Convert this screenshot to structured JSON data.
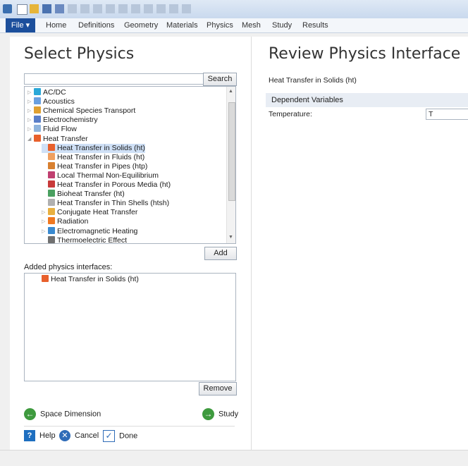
{
  "ribbon": {
    "file_label": "File ▾",
    "tabs": [
      "Home",
      "Definitions",
      "Geometry",
      "Materials",
      "Physics",
      "Mesh",
      "Study",
      "Results"
    ]
  },
  "left": {
    "title": "Select Physics",
    "search_button": "Search",
    "tree": [
      {
        "label": "AC/DC",
        "tri": "▷",
        "indent": 0,
        "icon": "acdc"
      },
      {
        "label": "Acoustics",
        "tri": "▷",
        "indent": 0,
        "icon": "acoustics"
      },
      {
        "label": "Chemical Species Transport",
        "tri": "▷",
        "indent": 0,
        "icon": "chem"
      },
      {
        "label": "Electrochemistry",
        "tri": "▷",
        "indent": 0,
        "icon": "echem"
      },
      {
        "label": "Fluid Flow",
        "tri": "▷",
        "indent": 0,
        "icon": "fluid"
      },
      {
        "label": "Heat Transfer",
        "tri": "◢",
        "indent": 0,
        "icon": "heat"
      },
      {
        "label": "Heat Transfer in Solids (ht)",
        "tri": "",
        "indent": 1,
        "icon": "solids",
        "selected": true
      },
      {
        "label": "Heat Transfer in Fluids (ht)",
        "tri": "",
        "indent": 1,
        "icon": "fluids"
      },
      {
        "label": "Heat Transfer in Pipes (htp)",
        "tri": "",
        "indent": 1,
        "icon": "pipes"
      },
      {
        "label": "Local Thermal Non-Equilibrium",
        "tri": "",
        "indent": 1,
        "icon": "ltne"
      },
      {
        "label": "Heat Transfer in Porous Media (ht)",
        "tri": "",
        "indent": 1,
        "icon": "porous"
      },
      {
        "label": "Bioheat Transfer (ht)",
        "tri": "",
        "indent": 1,
        "icon": "bio"
      },
      {
        "label": "Heat Transfer in Thin Shells (htsh)",
        "tri": "",
        "indent": 1,
        "icon": "shell"
      },
      {
        "label": "Conjugate Heat Transfer",
        "tri": "▷",
        "indent": 1,
        "icon": "conj"
      },
      {
        "label": "Radiation",
        "tri": "▷",
        "indent": 1,
        "icon": "rad"
      },
      {
        "label": "Electromagnetic Heating",
        "tri": "▷",
        "indent": 1,
        "icon": "emh"
      },
      {
        "label": "Thermoelectric Effect",
        "tri": "",
        "indent": 1,
        "icon": "thermo"
      }
    ],
    "add_button": "Add",
    "added_label": "Added physics interfaces:",
    "added_items": [
      "Heat Transfer in Solids (ht)"
    ],
    "remove_button": "Remove",
    "space_dimension": "Space Dimension",
    "study": "Study",
    "help": "Help",
    "cancel": "Cancel",
    "done": "Done"
  },
  "right": {
    "title": "Review Physics Interface",
    "subtitle": "Heat Transfer in Solids (ht)",
    "section": "Dependent Variables",
    "temperature_label": "Temperature:",
    "temperature_value": "T"
  },
  "colors": {
    "file_button": "#1c4f9c",
    "selection": "#cfe0f6",
    "nav_green": "#3e9a3e",
    "help_blue": "#1e6fc0",
    "heat_orange": "#e8602c"
  }
}
